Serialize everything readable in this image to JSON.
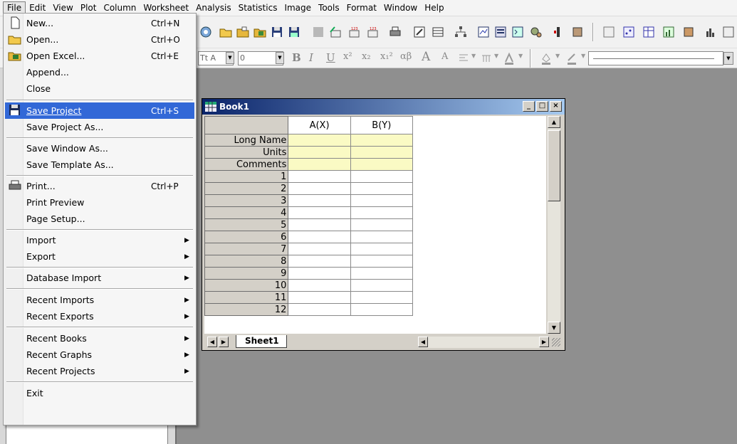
{
  "menubar": {
    "items": [
      "File",
      "Edit",
      "View",
      "Plot",
      "Column",
      "Worksheet",
      "Analysis",
      "Statistics",
      "Image",
      "Tools",
      "Format",
      "Window",
      "Help"
    ]
  },
  "format_toolbar": {
    "font_name": "Tt A",
    "font_size": "0",
    "text_buttons": [
      "B",
      "I",
      "U",
      "x²",
      "x₂",
      "x₁²",
      "αβ",
      "A",
      "A"
    ]
  },
  "file_menu": {
    "items": [
      {
        "label": "New...",
        "shortcut": "Ctrl+N",
        "icon": "new-file-icon"
      },
      {
        "label": "Open...",
        "shortcut": "Ctrl+O",
        "icon": "open-folder-icon"
      },
      {
        "label": "Open Excel...",
        "shortcut": "Ctrl+E",
        "icon": "excel-icon"
      },
      {
        "label": "Append..."
      },
      {
        "label": "Close"
      },
      {
        "label": "Save Project",
        "shortcut": "Ctrl+S",
        "icon": "save-icon",
        "highlighted": true
      },
      {
        "label": "Save Project As..."
      },
      {
        "label": "Save Window As..."
      },
      {
        "label": "Save Template As..."
      },
      {
        "label": "Print...",
        "shortcut": "Ctrl+P",
        "icon": "printer-icon"
      },
      {
        "label": "Print Preview"
      },
      {
        "label": "Page Setup..."
      },
      {
        "label": "Import",
        "submenu": true
      },
      {
        "label": "Export",
        "submenu": true
      },
      {
        "label": "Database Import",
        "submenu": true
      },
      {
        "label": "Recent Imports",
        "submenu": true
      },
      {
        "label": "Recent Exports",
        "submenu": true
      },
      {
        "label": "Recent Books",
        "submenu": true
      },
      {
        "label": "Recent Graphs",
        "submenu": true
      },
      {
        "label": "Recent Projects",
        "submenu": true
      },
      {
        "label": "Exit"
      }
    ]
  },
  "book": {
    "title": "Book1",
    "columns": [
      "A(X)",
      "B(Y)"
    ],
    "header_rows": [
      "Long Name",
      "Units",
      "Comments"
    ],
    "row_numbers": [
      "1",
      "2",
      "3",
      "4",
      "5",
      "6",
      "7",
      "8",
      "9",
      "10",
      "11",
      "12"
    ],
    "sheet_tab": "Sheet1",
    "window_buttons": [
      "_",
      "□",
      "×"
    ]
  },
  "colors": {
    "menu_highlight": "#3268d7",
    "title_bar": "#0a246a",
    "header_cell": "#fafac4",
    "workspace": "#8f8f8f"
  }
}
